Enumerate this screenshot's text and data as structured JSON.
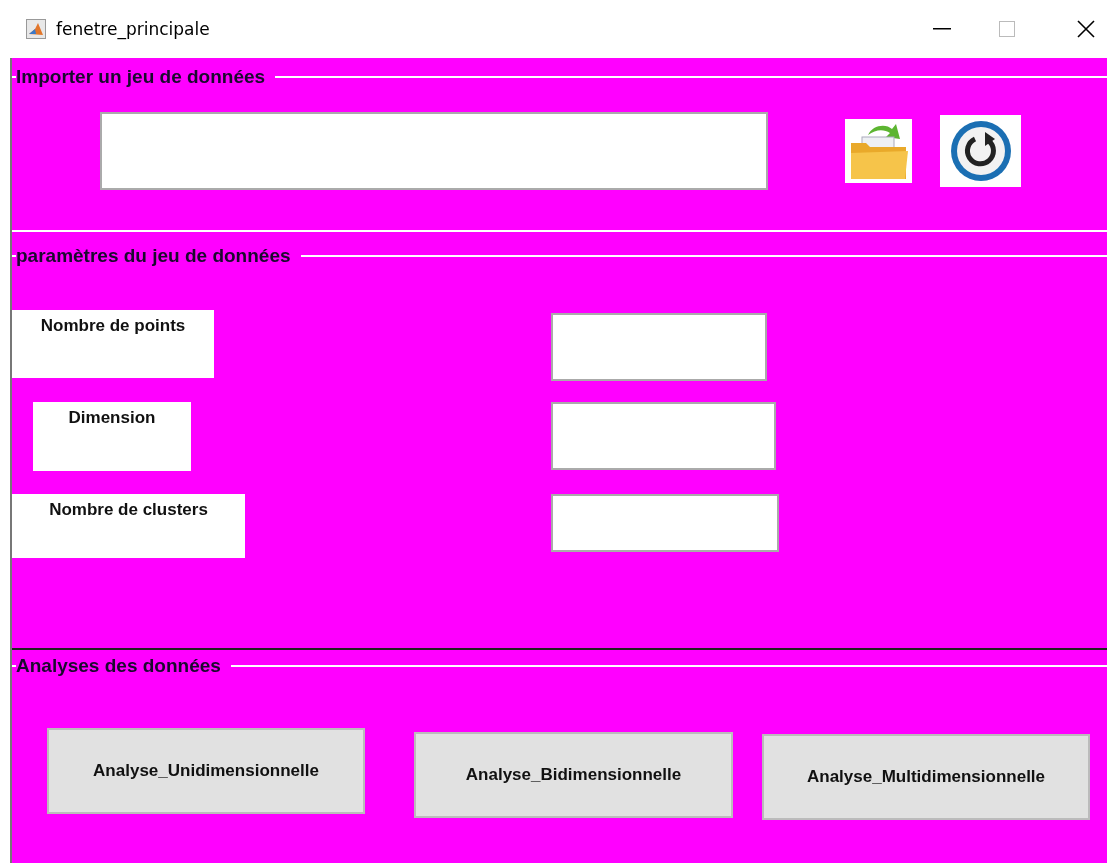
{
  "window": {
    "title": "fenetre_principale"
  },
  "import_panel": {
    "title": "Importer un jeu de données"
  },
  "parameters_panel": {
    "title": "paramètres du jeu de données",
    "rows": [
      {
        "label": "Nombre de points"
      },
      {
        "label": "Dimension"
      },
      {
        "label": "Nombre de clusters"
      }
    ]
  },
  "analysis_panel": {
    "title": "Analyses des données",
    "buttons": [
      "Analyse_Unidimensionnelle",
      "Analyse_Bidimensionnelle",
      "Analyse_Multidimensionnelle"
    ]
  }
}
